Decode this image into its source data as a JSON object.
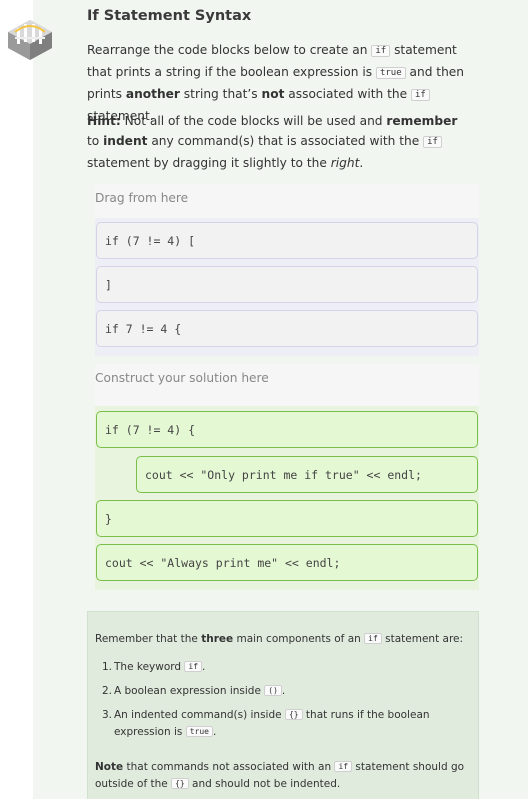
{
  "page": {
    "title": "If Statement Syntax"
  },
  "instructions": {
    "p1_a": "Rearrange the code blocks below to create an ",
    "p1_code1": "if",
    "p1_b": " statement that prints a string if the boolean expression is ",
    "p1_code2": "true",
    "p1_c": " and then prints ",
    "p1_bold": "another",
    "p1_d": " string that’s ",
    "p1_bold2": "not",
    "p1_e": " associated with the ",
    "p1_code3": "if",
    "p1_f": " statement.",
    "hint_label": "Hint:",
    "hint_a": " Not all of the code blocks will be used and ",
    "hint_bold1": "remember",
    "hint_b": " to ",
    "hint_bold2": "indent",
    "hint_c": " any command(s) that is associated with the ",
    "hint_code": "if",
    "hint_d": " statement by dragging it slightly to the ",
    "hint_italic": "right",
    "hint_e": "."
  },
  "source": {
    "label": "Drag from here",
    "blocks": [
      "if (7 != 4) [",
      "]",
      "if 7 != 4 {"
    ]
  },
  "solution": {
    "label": "Construct your solution here",
    "blocks": [
      "if (7 != 4) {",
      "cout << \"Only print me if true\" << endl;",
      "}",
      "cout << \"Always print me\" << endl;"
    ]
  },
  "note": {
    "intro_a": "Remember that the ",
    "intro_bold": "three",
    "intro_b": " main components of an ",
    "intro_code": "if",
    "intro_c": " statement are:",
    "items": [
      {
        "num": "1.",
        "a": "The keyword ",
        "code": "if",
        "b": "."
      },
      {
        "num": "2.",
        "a": "A boolean expression inside ",
        "code": "()",
        "b": "."
      },
      {
        "num": "3.",
        "a": "An indented command(s) inside ",
        "code": "{}",
        "b": " that runs if the boolean expression is ",
        "code2": "true",
        "c": "."
      }
    ],
    "note_bold": "Note",
    "note_a": " that commands not associated with an ",
    "note_code1": "if",
    "note_b": " statement should go outside of the ",
    "note_code2": "{}",
    "note_c": " and should not be indented."
  },
  "colors": {
    "page_bg": "#f1f6f1",
    "solution_block": "#e5f8d4",
    "solution_border": "#7bbf4a",
    "source_border": "#d6d3e6"
  },
  "icons": {
    "logo": "bridge-logo-icon"
  }
}
